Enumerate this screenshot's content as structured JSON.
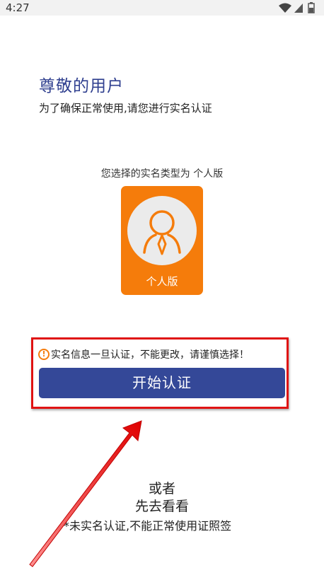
{
  "status_bar": {
    "time": "4:27",
    "icons": [
      "wifi-icon",
      "signal-icon",
      "battery-icon"
    ]
  },
  "greeting": {
    "title": "尊敬的用户",
    "subtitle": "为了确保正常使用,请您进行实名认证"
  },
  "selection": {
    "text": "您选择的实名类型为 个人版",
    "card_label": "个人版",
    "card_icon": "person-icon"
  },
  "warning": {
    "icon": "!",
    "text": "实名信息一旦认证，不能更改，请谨慎选择！"
  },
  "start_button": {
    "label": "开始认证"
  },
  "alternative": {
    "or_text": "或者",
    "look_first_label": "先去看看",
    "footnote": "*未实名认证,不能正常使用证照签"
  },
  "colors": {
    "primary": "#344898",
    "title": "#2f3f8f",
    "card": "#f57c0b",
    "highlight": "#e01313"
  }
}
